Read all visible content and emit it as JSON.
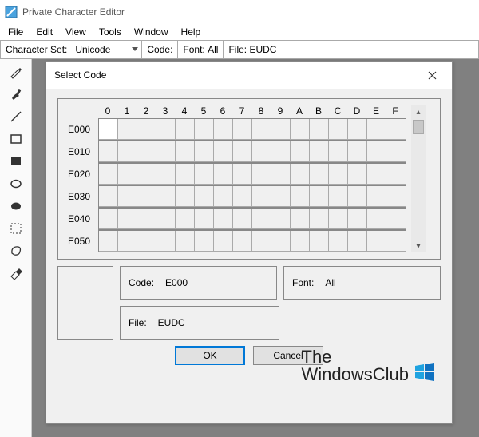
{
  "titlebar": {
    "title": "Private Character Editor"
  },
  "menubar": {
    "items": [
      "File",
      "Edit",
      "View",
      "Tools",
      "Window",
      "Help"
    ]
  },
  "infobar": {
    "charset_label": "Character Set:",
    "charset_value": "Unicode",
    "code_label": "Code:",
    "font_label": "Font:",
    "font_value": "All",
    "file_label": "File:",
    "file_value": "EUDC"
  },
  "tools": [
    "pencil",
    "brush",
    "line",
    "rect-outline",
    "rect-filled",
    "ellipse-outline",
    "ellipse-filled",
    "select",
    "freeform",
    "eraser"
  ],
  "dialog": {
    "title": "Select Code",
    "cols": [
      "0",
      "1",
      "2",
      "3",
      "4",
      "5",
      "6",
      "7",
      "8",
      "9",
      "A",
      "B",
      "C",
      "D",
      "E",
      "F"
    ],
    "rows": [
      "E000",
      "E010",
      "E020",
      "E030",
      "E040",
      "E050"
    ],
    "code_label": "Code:",
    "code_value": "E000",
    "font_label": "Font:",
    "font_value": "All",
    "file_label": "File:",
    "file_value": "EUDC",
    "ok": "OK",
    "cancel": "Cancel"
  },
  "watermark": {
    "line1": "The",
    "line2": "WindowsClub"
  }
}
